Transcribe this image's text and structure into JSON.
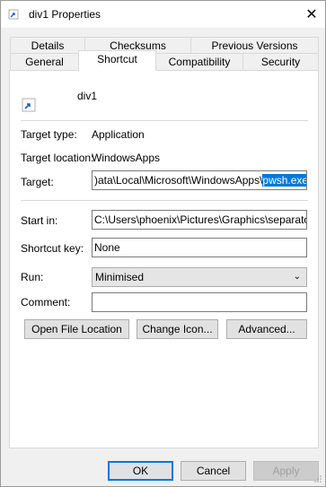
{
  "window": {
    "title": "div1 Properties",
    "close_glyph": "✕"
  },
  "tabs": {
    "row_back": [
      "Details",
      "Checksums",
      "Previous Versions"
    ],
    "row_front": [
      "General",
      "Shortcut",
      "Compatibility",
      "Security"
    ],
    "active": "Shortcut"
  },
  "shortcut": {
    "name": "div1",
    "target_type_label": "Target type:",
    "target_type_value": "Application",
    "target_location_label": "Target location:",
    "target_location_value": "WindowsApps",
    "target_label": "Target:",
    "target_value_unselected": ")ata\\Local\\Microsoft\\WindowsApps\\",
    "target_value_selected": "pwsh.exe -l",
    "start_in_label": "Start in:",
    "start_in_value": "C:\\Users\\phoenix\\Pictures\\Graphics\\separators",
    "shortcut_key_label": "Shortcut key:",
    "shortcut_key_value": "None",
    "run_label": "Run:",
    "run_value": "Minimised",
    "comment_label": "Comment:",
    "comment_value": "",
    "open_location_label": "Open File Location",
    "change_icon_label": "Change Icon...",
    "advanced_label": "Advanced..."
  },
  "footer": {
    "ok_label": "OK",
    "cancel_label": "Cancel",
    "apply_label": "Apply"
  },
  "colors": {
    "selection": "#0078d7",
    "window_bg": "#f0f0f0",
    "panel_bg": "#ffffff"
  }
}
